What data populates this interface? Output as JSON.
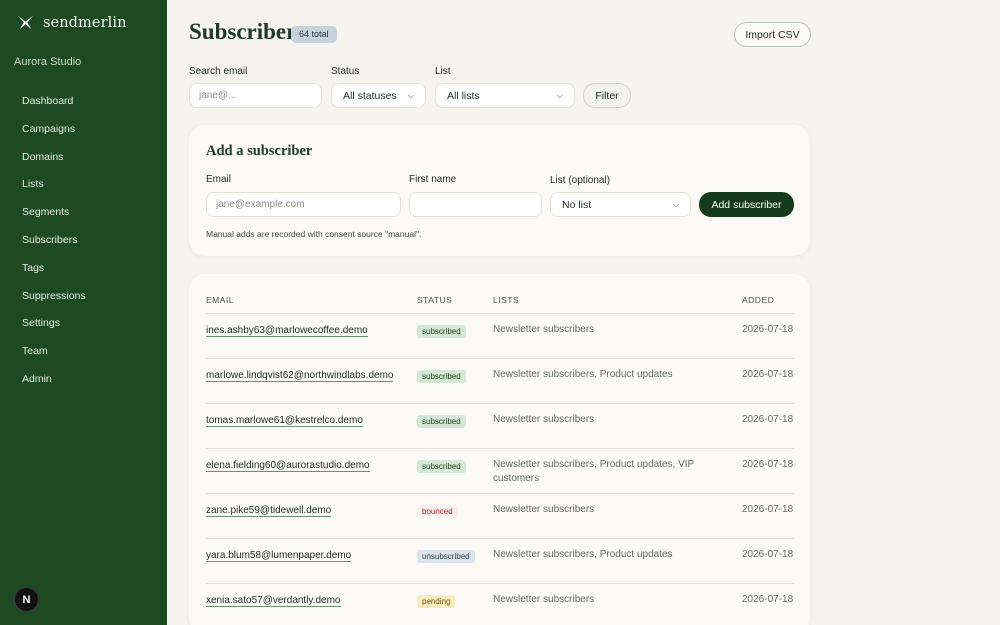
{
  "brand": {
    "name": "sendmerlin",
    "org": "Aurora Studio"
  },
  "nav": [
    "Dashboard",
    "Campaigns",
    "Domains",
    "Lists",
    "Segments",
    "Subscribers",
    "Tags",
    "Suppressions",
    "Settings",
    "Team",
    "Admin"
  ],
  "avatar": "N",
  "header": {
    "title": "Subscribers",
    "total": "64 total",
    "import_label": "Import CSV"
  },
  "filters": {
    "search_label": "Search email",
    "search_placeholder": "jane@...",
    "status_label": "Status",
    "status_value": "All statuses",
    "list_label": "List",
    "list_value": "All lists",
    "filter_label": "Filter"
  },
  "add_form": {
    "title": "Add a subscriber",
    "email_label": "Email",
    "email_placeholder": "jane@example.com",
    "first_name_label": "First name",
    "list_label": "List (optional)",
    "list_value": "No list",
    "submit_label": "Add subscriber",
    "note": "Manual adds are recorded with consent source \"manual\"."
  },
  "table": {
    "headers": {
      "email": "EMAIL",
      "status": "STATUS",
      "lists": "LISTS",
      "added": "ADDED"
    },
    "rows": [
      {
        "email": "ines.ashby63@marlowecoffee.demo",
        "status": "subscribed",
        "lists": "Newsletter subscribers",
        "added": "2026-07-18"
      },
      {
        "email": "marlowe.lindqvist62@northwindlabs.demo",
        "status": "subscribed",
        "lists": "Newsletter subscribers, Product updates",
        "added": "2026-07-18"
      },
      {
        "email": "tomas.marlowe61@kestrelco.demo",
        "status": "subscribed",
        "lists": "Newsletter subscribers",
        "added": "2026-07-18"
      },
      {
        "email": "elena.fielding60@aurorastudio.demo",
        "status": "subscribed",
        "lists": "Newsletter subscribers, Product updates, VIP customers",
        "added": "2026-07-18"
      },
      {
        "email": "zane.pike59@tidewell.demo",
        "status": "bounced",
        "lists": "Newsletter subscribers",
        "added": "2026-07-18"
      },
      {
        "email": "yara.blum58@lumenpaper.demo",
        "status": "unsubscribed",
        "lists": "Newsletter subscribers, Product updates",
        "added": "2026-07-18"
      },
      {
        "email": "xenia.sato57@verdantly.demo",
        "status": "pending",
        "lists": "Newsletter subscribers",
        "added": "2026-07-18"
      }
    ]
  },
  "colors": {
    "sidebar": "#1d4a22",
    "primary_button": "#163a1c",
    "background": "#f6f4ee"
  }
}
